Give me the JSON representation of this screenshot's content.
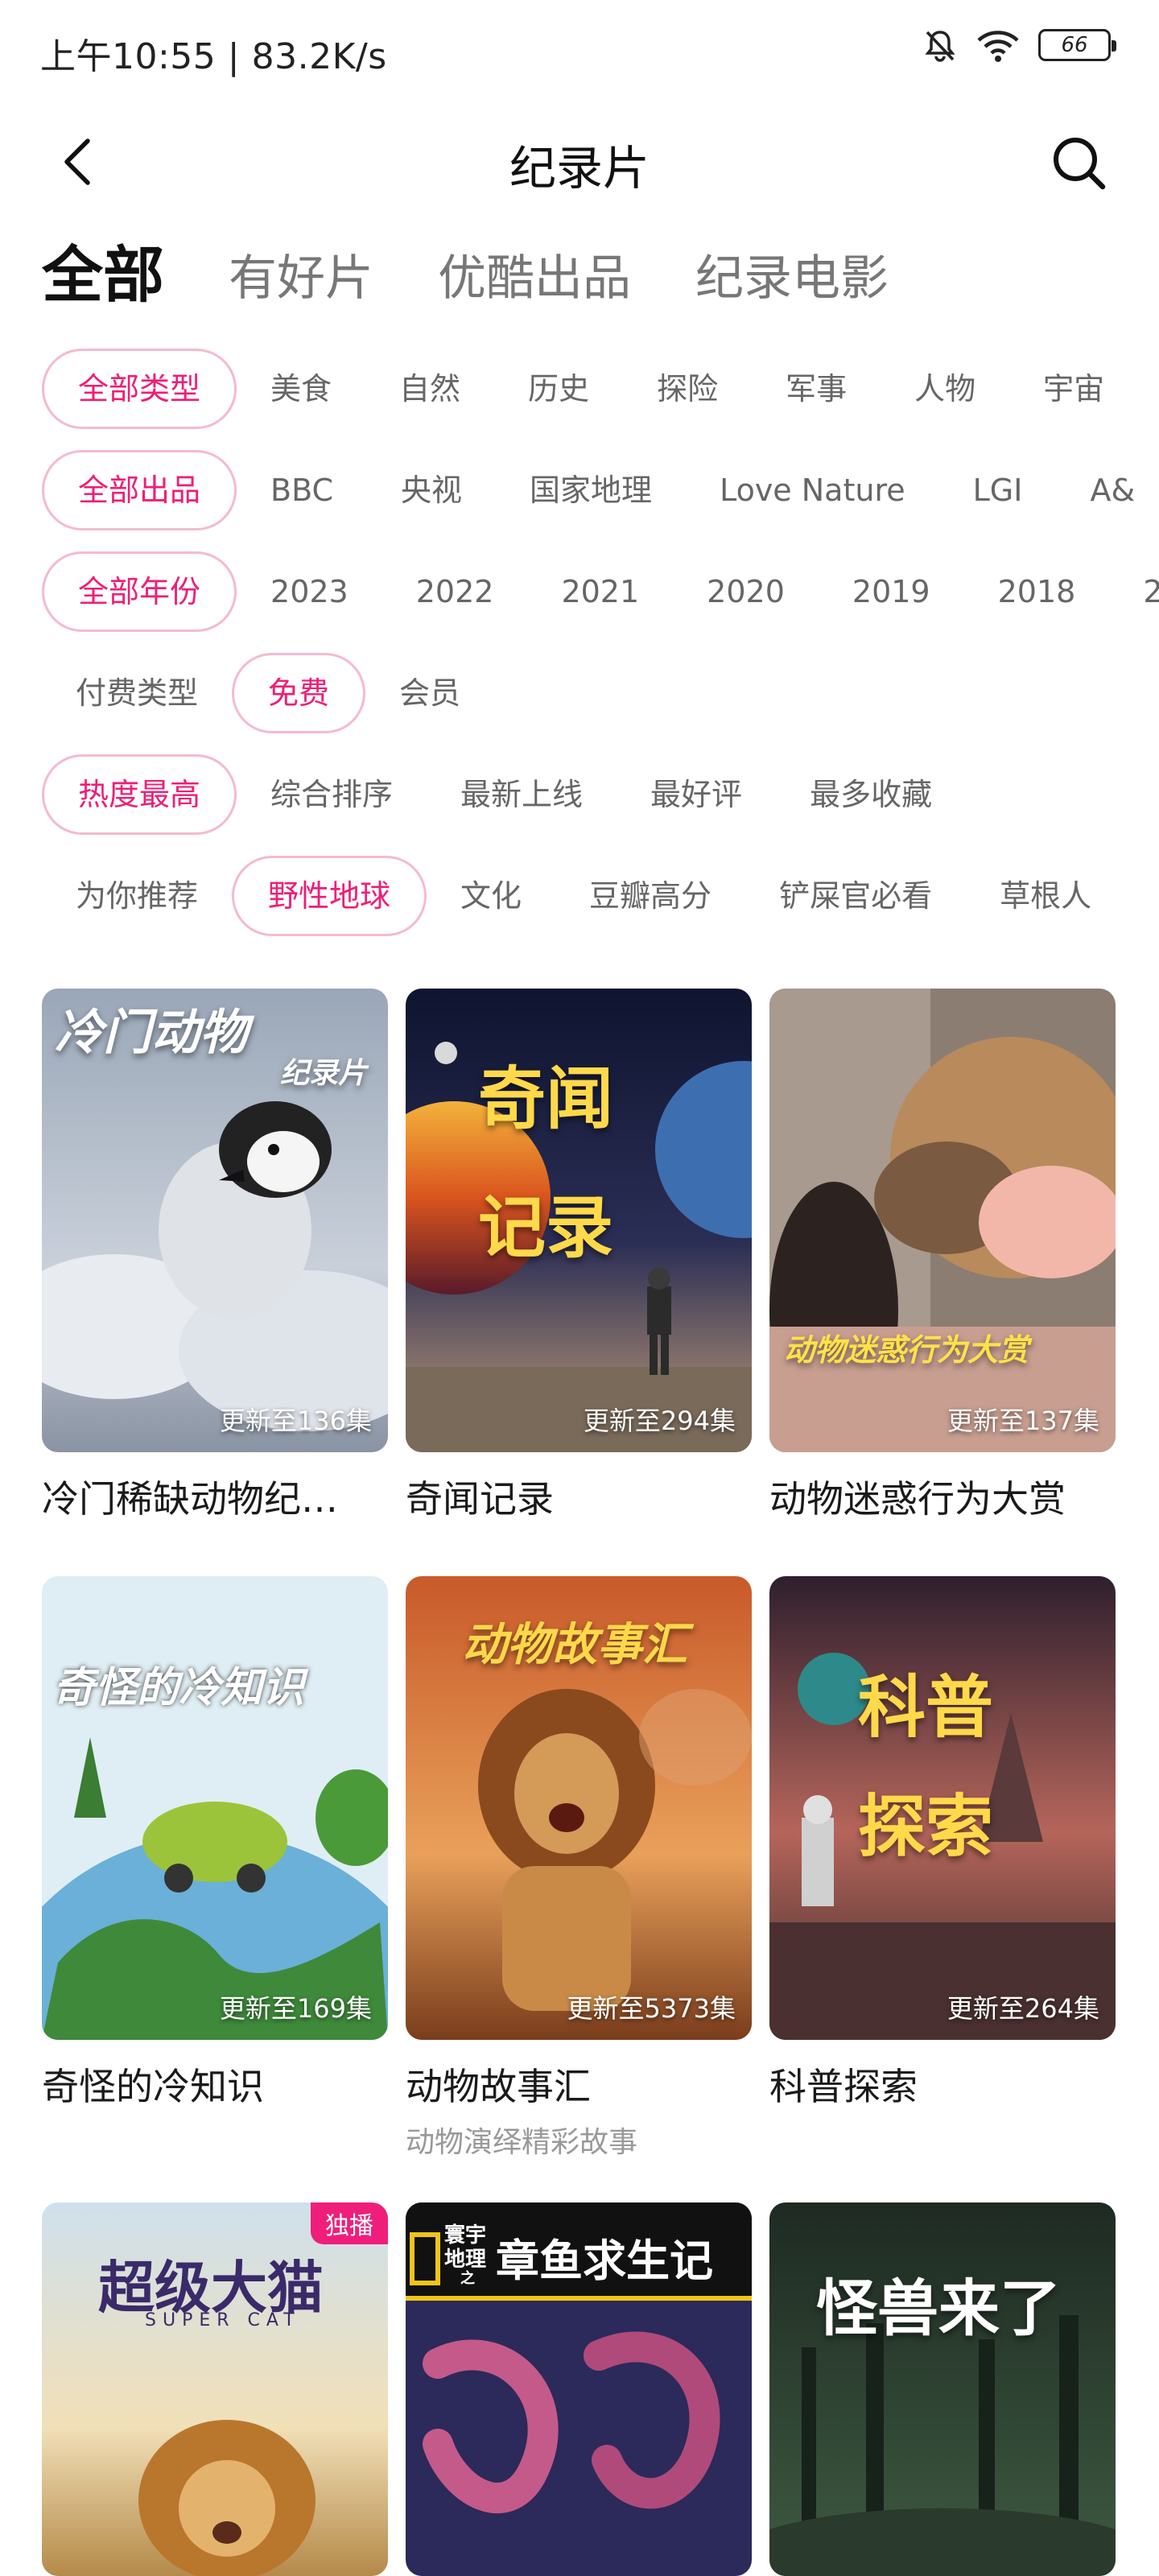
{
  "status": {
    "time": "上午10:55 | 83.2K/s",
    "battery": "66"
  },
  "header": {
    "title": "纪录片"
  },
  "main_tabs": [
    {
      "label": "全部",
      "active": true
    },
    {
      "label": "有好片",
      "active": false
    },
    {
      "label": "优酷出品",
      "active": false
    },
    {
      "label": "纪录电影",
      "active": false
    }
  ],
  "filters": {
    "type": [
      "全部类型",
      "美食",
      "自然",
      "历史",
      "探险",
      "军事",
      "人物",
      "宇宙"
    ],
    "producer": [
      "全部出品",
      "BBC",
      "央视",
      "国家地理",
      "Love Nature",
      "LGI",
      "A&"
    ],
    "year": [
      "全部年份",
      "2023",
      "2022",
      "2021",
      "2020",
      "2019",
      "2018",
      "2"
    ],
    "pay": [
      "付费类型",
      "免费",
      "会员"
    ],
    "sort": [
      "热度最高",
      "综合排序",
      "最新上线",
      "最好评",
      "最多收藏"
    ],
    "tag": [
      "为你推荐",
      "野性地球",
      "文化",
      "豆瓣高分",
      "铲屎官必看",
      "草根人"
    ]
  },
  "selected_filters": {
    "type": 0,
    "producer": 0,
    "year": 0,
    "pay": 1,
    "sort": 0,
    "tag": 1
  },
  "accent_color": "#ee1e76",
  "cards": [
    {
      "title": "冷门稀缺动物纪…",
      "episodes": "更新至136集",
      "poster_text": [
        "冷门动物",
        "纪录片"
      ]
    },
    {
      "title": "奇闻记录",
      "episodes": "更新至294集",
      "poster_text": [
        "奇闻",
        "记录"
      ]
    },
    {
      "title": "动物迷惑行为大赏",
      "episodes": "更新至137集",
      "poster_text": [
        "动物迷惑行为大赏"
      ]
    },
    {
      "title": "奇怪的冷知识",
      "episodes": "更新至169集",
      "poster_text": [
        "奇怪的冷知识"
      ]
    },
    {
      "title": "动物故事汇",
      "subtitle": "动物演绎精彩故事",
      "episodes": "更新至5373集",
      "poster_text": [
        "动物故事汇"
      ]
    },
    {
      "title": "科普探索",
      "episodes": "更新至264集",
      "poster_text": [
        "科普",
        "探索"
      ]
    },
    {
      "badge": "独播",
      "poster_text": [
        "超级大猫",
        "SUPER CAT"
      ]
    },
    {
      "poster_text": [
        "寰宇",
        "地理",
        "之",
        "章鱼求生记"
      ]
    },
    {
      "poster_text": [
        "怪兽来了"
      ]
    }
  ]
}
